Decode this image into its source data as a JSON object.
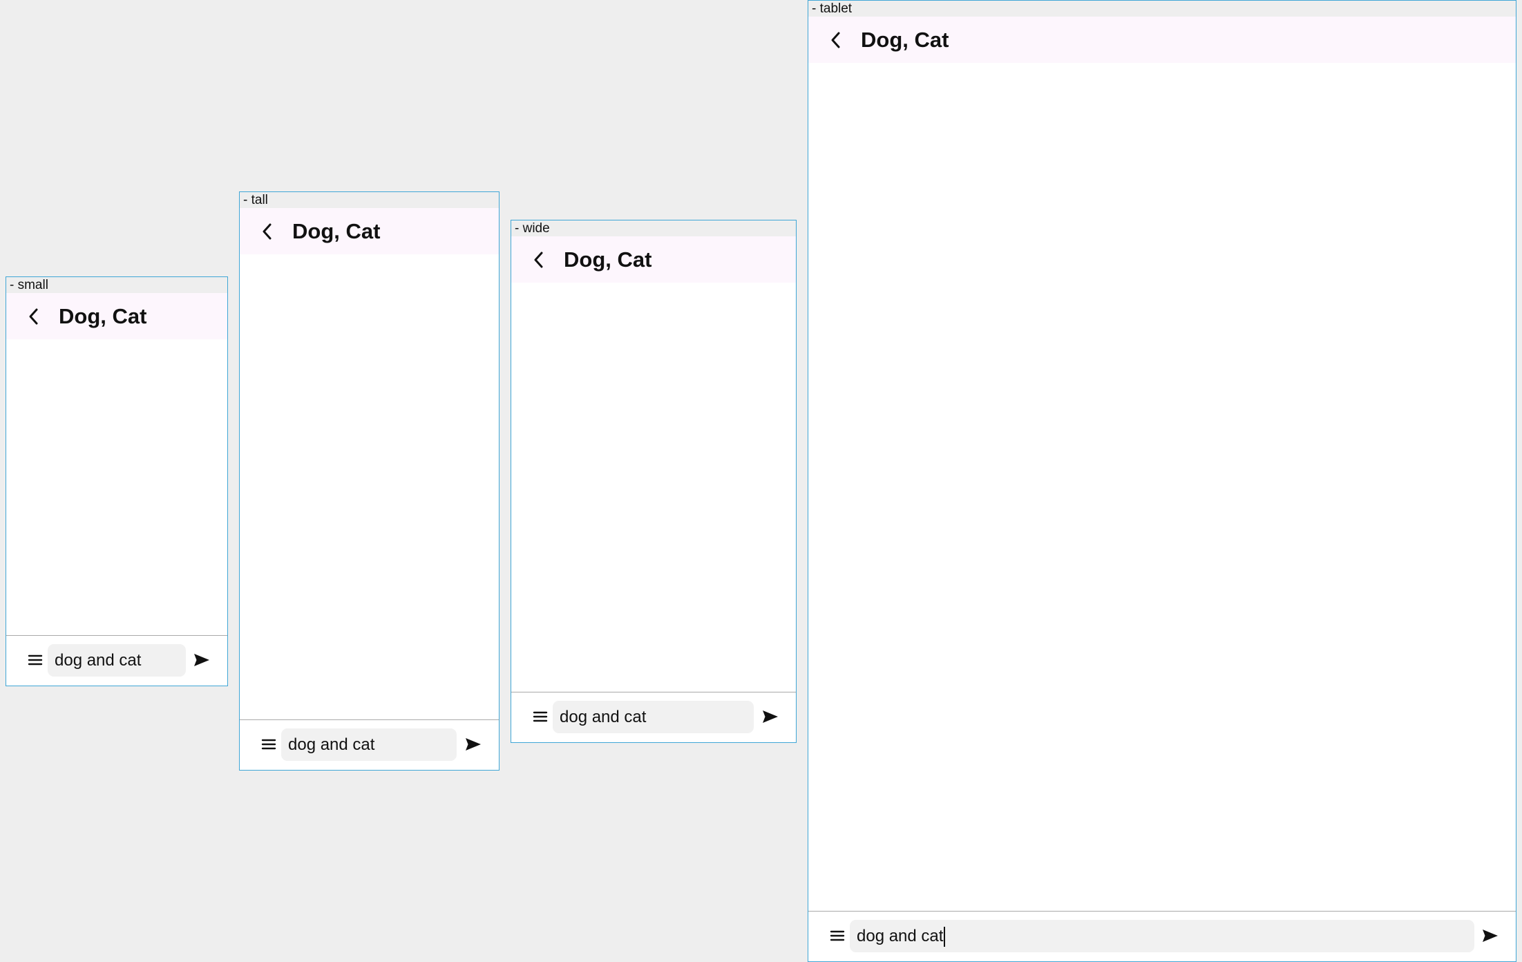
{
  "frames": [
    {
      "id": "small",
      "label": "- small",
      "title": "Dog, Cat",
      "input_value": "dog and cat"
    },
    {
      "id": "tall",
      "label": "- tall",
      "title": "Dog, Cat",
      "input_value": "dog and cat"
    },
    {
      "id": "wide",
      "label": "- wide",
      "title": "Dog, Cat",
      "input_value": "dog and cat"
    },
    {
      "id": "tablet",
      "label": "- tablet",
      "title": "Dog, Cat",
      "input_value": "dog and cat"
    }
  ],
  "icons": {
    "back": "chevron-left-icon",
    "menu": "menu-icon",
    "send": "send-icon"
  },
  "colors": {
    "canvas_background": "#eeeeee",
    "frame_border": "#3fa6d6",
    "app_bar_background": "#fdf6fd",
    "input_background": "#f1f1f1",
    "divider": "#a9a9a9"
  }
}
